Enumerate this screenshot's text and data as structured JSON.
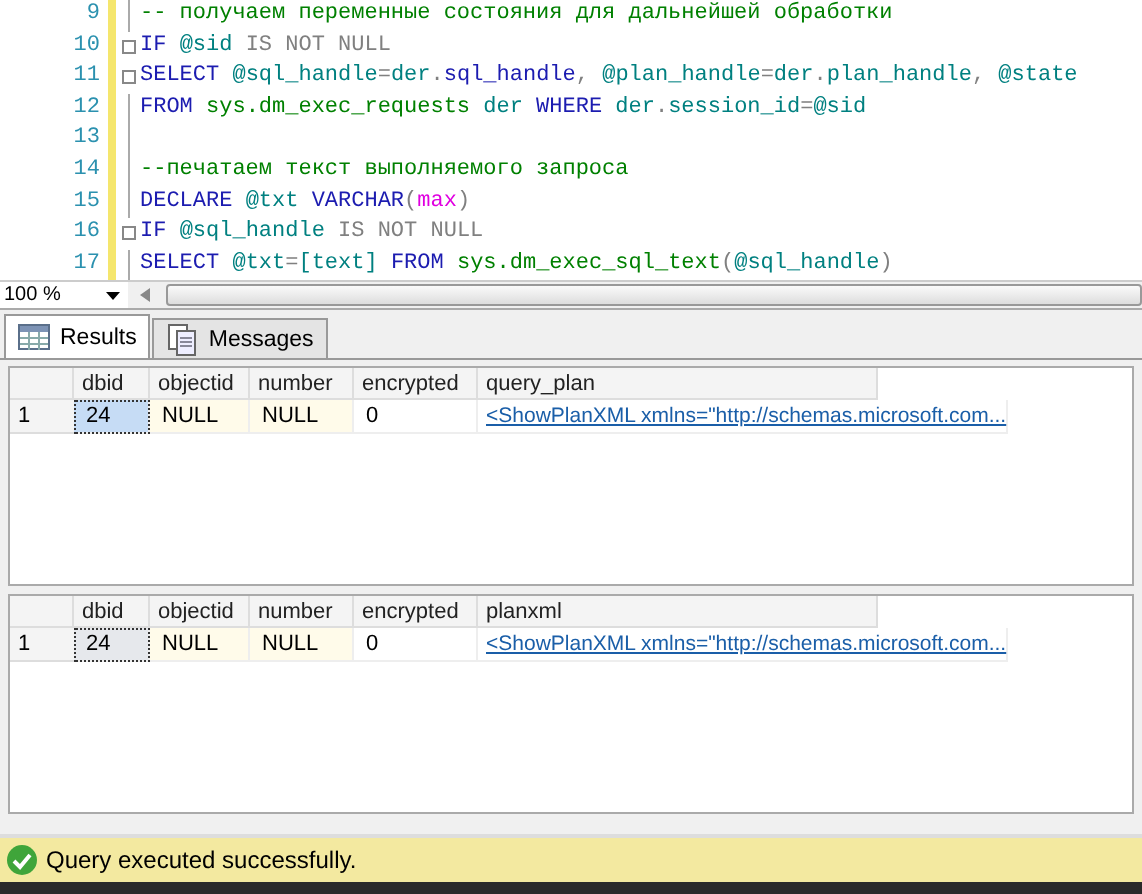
{
  "editor": {
    "lines": [
      {
        "number": "9",
        "fold": false,
        "tokens": [
          {
            "kind": "comment",
            "text": "-- получаем переменные состояния для дальнейшей обработки"
          }
        ]
      },
      {
        "number": "10",
        "fold": true,
        "tokens": [
          {
            "kind": "keyword",
            "text": "IF "
          },
          {
            "kind": "var",
            "text": "@sid "
          },
          {
            "kind": "gray",
            "text": "IS NOT NULL"
          }
        ]
      },
      {
        "number": "11",
        "fold": true,
        "tokens": [
          {
            "kind": "keyword",
            "text": "SELECT "
          },
          {
            "kind": "var",
            "text": "@sql_handle"
          },
          {
            "kind": "gray",
            "text": "="
          },
          {
            "kind": "var",
            "text": "der"
          },
          {
            "kind": "gray",
            "text": "."
          },
          {
            "kind": "keyword",
            "text": "sql_handle"
          },
          {
            "kind": "gray",
            "text": ", "
          },
          {
            "kind": "var",
            "text": "@plan_handle"
          },
          {
            "kind": "gray",
            "text": "="
          },
          {
            "kind": "var",
            "text": "der"
          },
          {
            "kind": "gray",
            "text": "."
          },
          {
            "kind": "var",
            "text": "plan_handle"
          },
          {
            "kind": "gray",
            "text": ", "
          },
          {
            "kind": "var",
            "text": "@state"
          }
        ]
      },
      {
        "number": "12",
        "fold": false,
        "tokens": [
          {
            "kind": "keyword",
            "text": "FROM "
          },
          {
            "kind": "func",
            "text": "sys.dm_exec_requests "
          },
          {
            "kind": "var",
            "text": "der "
          },
          {
            "kind": "keyword",
            "text": "WHERE "
          },
          {
            "kind": "var",
            "text": "der"
          },
          {
            "kind": "gray",
            "text": "."
          },
          {
            "kind": "var",
            "text": "session_id"
          },
          {
            "kind": "gray",
            "text": "="
          },
          {
            "kind": "var",
            "text": "@sid"
          }
        ]
      },
      {
        "number": "13",
        "fold": false
      },
      {
        "number": "14",
        "fold": false,
        "tokens": [
          {
            "kind": "comment",
            "text": "--печатаем текст выполняемого запроса"
          }
        ]
      },
      {
        "number": "15",
        "fold": false,
        "tokens": [
          {
            "kind": "keyword",
            "text": "DECLARE "
          },
          {
            "kind": "var",
            "text": "@txt "
          },
          {
            "kind": "keyword",
            "text": "VARCHAR"
          },
          {
            "kind": "gray",
            "text": "("
          },
          {
            "kind": "magenta",
            "text": "max"
          },
          {
            "kind": "gray",
            "text": ")"
          }
        ]
      },
      {
        "number": "16",
        "fold": true,
        "tokens": [
          {
            "kind": "keyword",
            "text": "IF "
          },
          {
            "kind": "var",
            "text": "@sql_handle "
          },
          {
            "kind": "gray",
            "text": "IS NOT NULL"
          }
        ]
      },
      {
        "number": "17",
        "fold": false,
        "tokens": [
          {
            "kind": "keyword",
            "text": "SELECT "
          },
          {
            "kind": "var",
            "text": "@txt"
          },
          {
            "kind": "gray",
            "text": "="
          },
          {
            "kind": "var",
            "text": "[text] "
          },
          {
            "kind": "keyword",
            "text": "FROM "
          },
          {
            "kind": "func",
            "text": "sys.dm_exec_sql_text"
          },
          {
            "kind": "gray",
            "text": "("
          },
          {
            "kind": "var",
            "text": "@sql_handle"
          },
          {
            "kind": "gray",
            "text": ")"
          }
        ]
      }
    ]
  },
  "zoom": "100 %",
  "tabs": [
    {
      "label": "Results",
      "selected": true
    },
    {
      "label": "Messages",
      "selected": false
    }
  ],
  "grids": [
    {
      "active": true,
      "columns": [
        "dbid",
        "objectid",
        "number",
        "encrypted",
        "query_plan"
      ],
      "rows": [
        {
          "row_number": "1",
          "cells": [
            {
              "kind": "text",
              "text": "24",
              "selected": true
            },
            {
              "kind": "null",
              "text": "NULL",
              "selected": false
            },
            {
              "kind": "null",
              "text": "NULL",
              "selected": false
            },
            {
              "kind": "text",
              "text": "0",
              "selected": false
            },
            {
              "kind": "link",
              "text": "<ShowPlanXML xmlns=\"http://schemas.microsoft.com...",
              "selected": false
            }
          ]
        }
      ]
    },
    {
      "active": false,
      "columns": [
        "dbid",
        "objectid",
        "number",
        "encrypted",
        "planxml"
      ],
      "rows": [
        {
          "row_number": "1",
          "cells": [
            {
              "kind": "text",
              "text": "24",
              "selected": true
            },
            {
              "kind": "null",
              "text": "NULL",
              "selected": false
            },
            {
              "kind": "null",
              "text": "NULL",
              "selected": false
            },
            {
              "kind": "text",
              "text": "0",
              "selected": false
            },
            {
              "kind": "link",
              "text": "<ShowPlanXML xmlns=\"http://schemas.microsoft.com...",
              "selected": false
            }
          ]
        }
      ]
    }
  ],
  "status_bar": {
    "message": "Query executed successfully.",
    "kind": "success"
  }
}
